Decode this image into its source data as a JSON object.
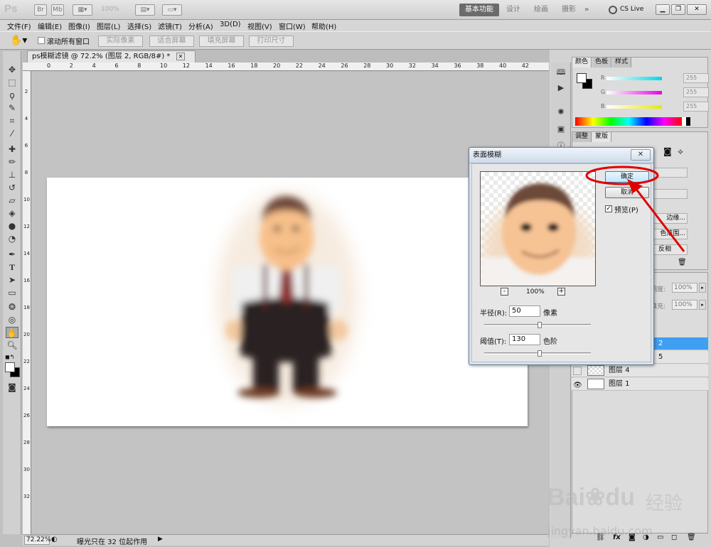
{
  "app": {
    "logo": "Ps",
    "zoom_display": "100%",
    "workspaces": [
      "基本功能",
      "设计",
      "绘画",
      "摄影"
    ],
    "overflow": "»",
    "cslive": "CS Live"
  },
  "menu": [
    "文件(F)",
    "编辑(E)",
    "图像(I)",
    "图层(L)",
    "选择(S)",
    "滤镜(T)",
    "分析(A)",
    "3D(D)",
    "视图(V)",
    "窗口(W)",
    "帮助(H)"
  ],
  "options": {
    "scroll_all": "滚动所有窗口",
    "buttons": [
      "实际像素",
      "适合屏幕",
      "填充屏幕",
      "打印尺寸"
    ]
  },
  "document": {
    "tab_title": "ps模糊滤镜 @ 72.2% (图层 2, RGB/8#) *",
    "ruler_top": [
      "0",
      "2",
      "4",
      "6",
      "8",
      "10",
      "12",
      "14",
      "16",
      "18",
      "20",
      "22",
      "24",
      "26",
      "28",
      "30",
      "32",
      "34",
      "36",
      "38",
      "40",
      "42"
    ],
    "ruler_left": [
      "2",
      "4",
      "6",
      "8",
      "10",
      "12",
      "14",
      "16",
      "18",
      "20",
      "22",
      "24",
      "26",
      "28",
      "30",
      "32"
    ]
  },
  "status": {
    "zoom": "72.22%",
    "message": "曝光只在 32 位起作用"
  },
  "color_panel": {
    "tabs": [
      "颜色",
      "色板",
      "样式"
    ],
    "channels": [
      {
        "label": "R",
        "value": "255",
        "color": "#00d8e8"
      },
      {
        "label": "G",
        "value": "255",
        "color": "#e800e8"
      },
      {
        "label": "B",
        "value": "255",
        "color": "#e8e800"
      }
    ]
  },
  "adjust_panel": {
    "tabs": [
      "调整",
      "蒙版"
    ],
    "btn_edge": "边缘...",
    "btn_color": "色范围...",
    "btn_invert": "反相"
  },
  "layers_panel": {
    "opacity_label": "明度:",
    "opacity": "100%",
    "fill_label": "填充:",
    "fill": "100%",
    "layers": [
      {
        "name": "2",
        "selected": true
      },
      {
        "name": "5",
        "selected": false
      },
      {
        "name": "图层 4",
        "selected": false
      },
      {
        "name": "图层 1",
        "selected": false
      }
    ],
    "footer_icons": [
      "link-icon",
      "fx-icon",
      "mask-icon",
      "adjustment-icon",
      "folder-icon",
      "new-layer-icon",
      "trash-icon"
    ]
  },
  "dialog": {
    "title": "表面模糊",
    "ok": "确定",
    "cancel": "取消",
    "preview_label": "预览(P)",
    "preview_checked": true,
    "zoom": "100%",
    "radius_label": "半径(R):",
    "radius_value": "50",
    "radius_unit": "像素",
    "radius_level": 0.52,
    "threshold_label": "阈值(T):",
    "threshold_value": "130",
    "threshold_unit": "色阶",
    "threshold_level": 0.52
  },
  "watermark": {
    "brand": "Bai",
    "brand2": "du",
    "cn": "经验",
    "url": "jingyan.baidu.com"
  },
  "accent": "#e00000",
  "selection_blue": "#3f9ff0"
}
